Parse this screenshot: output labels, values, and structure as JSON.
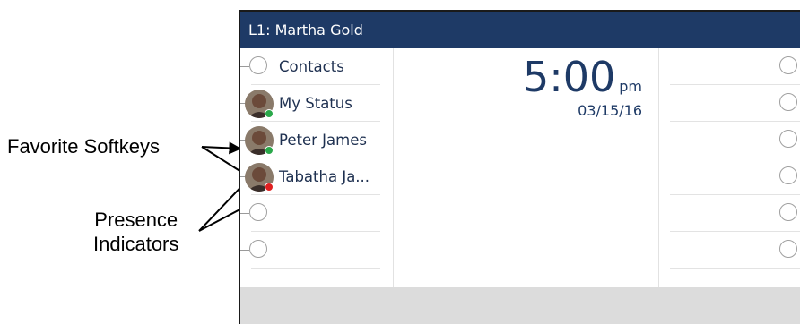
{
  "callouts": {
    "favorite_softkeys": "Favorite Softkeys",
    "presence_line1": "Presence",
    "presence_line2": "Indicators"
  },
  "screen": {
    "title": "L1: Martha Gold",
    "time": "5:00",
    "ampm": "pm",
    "date": "03/15/16"
  },
  "left_keys": [
    {
      "label": "Contacts",
      "type": "empty"
    },
    {
      "label": "My Status",
      "type": "avatar",
      "presence": "available",
      "presence_color": "#2aa84a"
    },
    {
      "label": "Peter James",
      "type": "avatar",
      "presence": "available",
      "presence_color": "#2aa84a"
    },
    {
      "label": "Tabatha Ja...",
      "type": "avatar",
      "presence": "busy",
      "presence_color": "#e02020"
    },
    {
      "label": "",
      "type": "empty"
    },
    {
      "label": "",
      "type": "empty"
    }
  ],
  "right_keys_count": 6,
  "colors": {
    "title_bar": "#1e3a66",
    "text": "#1e3050",
    "bottom_bar": "#dcdcdc"
  }
}
